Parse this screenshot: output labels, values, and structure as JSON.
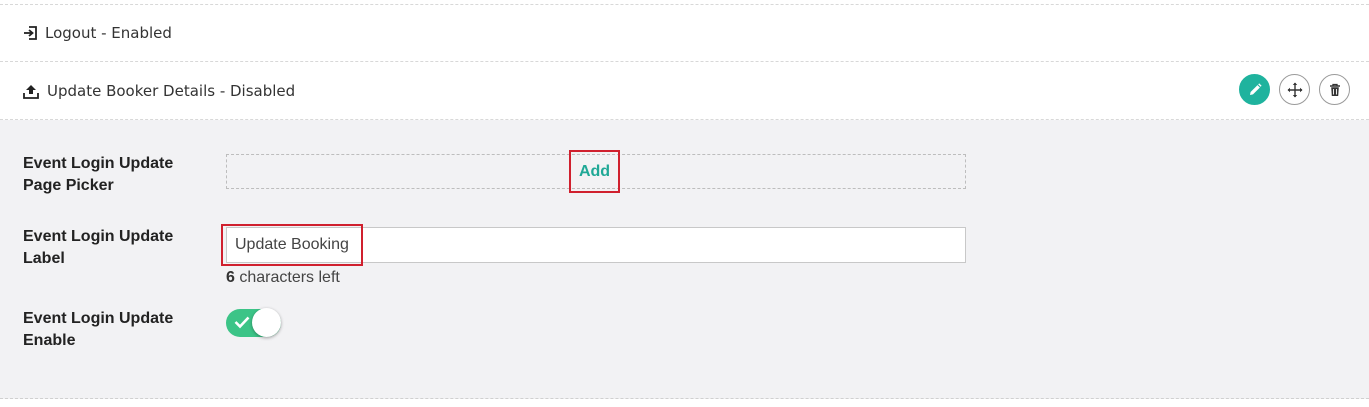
{
  "rows": {
    "logout": {
      "title": "Logout - Enabled",
      "icon": "login-arrow-icon"
    },
    "update_booker": {
      "title": "Update Booker Details - Disabled",
      "icon": "upload-icon",
      "actions": [
        "pencil-icon",
        "move-icon",
        "trash-icon"
      ]
    }
  },
  "panel": {
    "page_picker": {
      "label": "Event Login Update Page Picker",
      "add_label": "Add"
    },
    "label_field": {
      "label": "Event Login Update Label",
      "value": "Update Booking",
      "chars_left": "6",
      "chars_left_suffix": " characters left"
    },
    "enable_field": {
      "label": "Event Login Update Enable",
      "enabled": true
    }
  },
  "colors": {
    "accent": "#1fb39e",
    "toggle_on": "#3cc487",
    "highlight": "#d0202e",
    "panel_bg": "#f2f2f4"
  }
}
